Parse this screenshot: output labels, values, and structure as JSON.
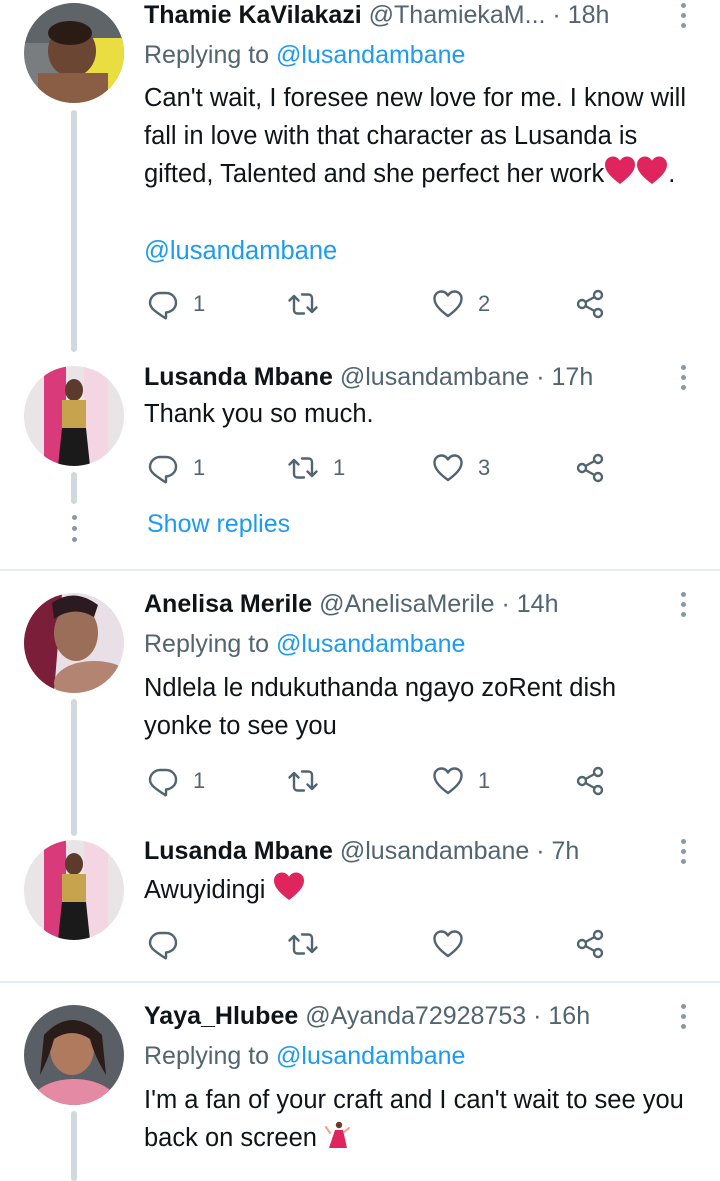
{
  "tweets": [
    {
      "name": "Thamie KaVilakazi",
      "handle": "@ThamiekaM...",
      "dot": "·",
      "time": "18h",
      "replying_prefix": "Replying to ",
      "replying_mention": "@lusandambane",
      "text": "Can't wait, I foresee new love for me. I know will fall in love with that character as Lusanda is gifted, Talented and she perfect her work",
      "text_suffix": ".",
      "tag": "@lusandambane",
      "replies": "1",
      "retweets": "",
      "likes": "2"
    },
    {
      "name": "Lusanda Mbane",
      "handle": "@lusandambane",
      "dot": "·",
      "time": "17h",
      "text": "Thank you so much.",
      "replies": "1",
      "retweets": "1",
      "likes": "3",
      "show_replies": "Show replies"
    },
    {
      "name": "Anelisa Merile",
      "handle": "@AnelisaMerile",
      "dot": "·",
      "time": "14h",
      "replying_prefix": "Replying to ",
      "replying_mention": "@lusandambane",
      "text": "Ndlela le ndukuthanda ngayo zoRent dish yonke to see you",
      "replies": "1",
      "retweets": "",
      "likes": "1"
    },
    {
      "name": "Lusanda Mbane",
      "handle": "@lusandambane",
      "dot": "·",
      "time": "7h",
      "text": "Awuyidingi",
      "replies": "",
      "retweets": "",
      "likes": ""
    },
    {
      "name": "Yaya_Hlubee",
      "handle": "@Ayanda72928753",
      "dot": "·",
      "time": "16h",
      "replying_prefix": "Replying to ",
      "replying_mention": "@lusandambane",
      "text": "I'm a fan of your craft and I can't wait to see you back on screen"
    }
  ],
  "icons": {
    "reply": "reply-icon",
    "retweet": "retweet-icon",
    "like": "heart-outline-icon",
    "share": "share-icon",
    "more": "more-icon",
    "heart_emoji": "red-heart-emoji",
    "dancer_emoji": "dancer-emoji"
  },
  "colors": {
    "link": "#1d9bf0",
    "secondary_text": "#536471",
    "thread_line": "#cfd9de",
    "divider": "#e6ecf0",
    "emoji_heart": "#e0245e"
  }
}
